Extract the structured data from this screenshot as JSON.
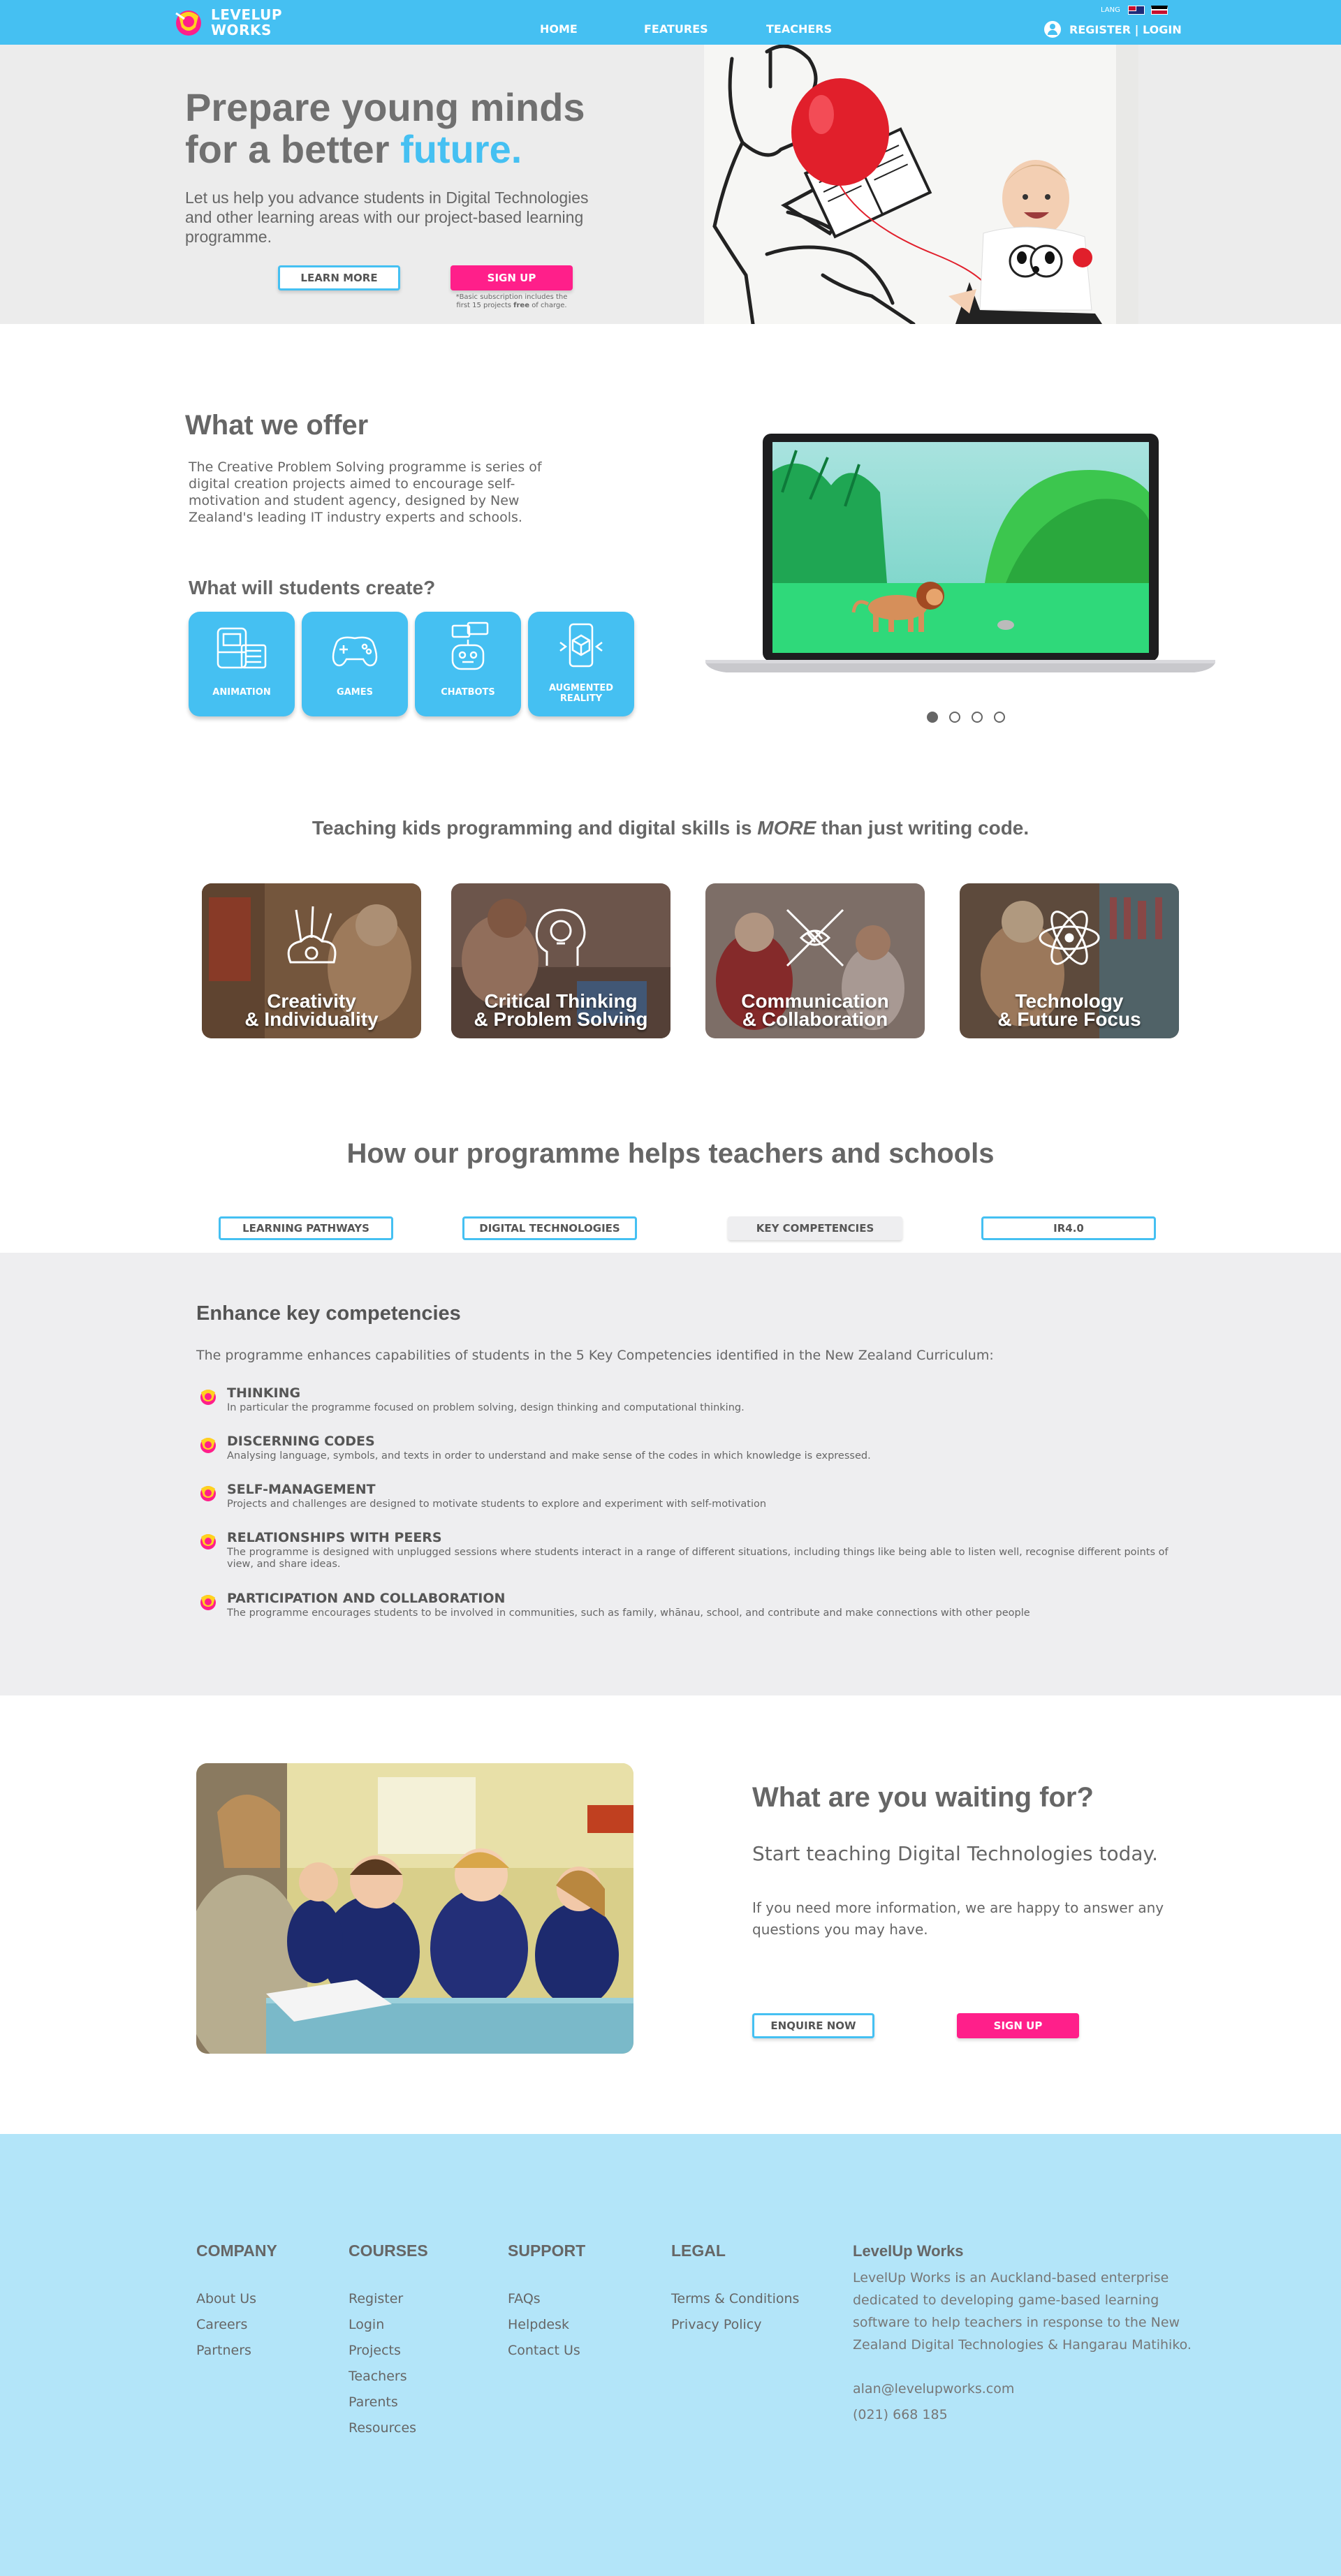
{
  "header": {
    "brand": "LEVELUP WORKS",
    "nav": [
      "HOME",
      "FEATURES",
      "TEACHERS"
    ],
    "lang_label": "LANG",
    "account": "REGISTER | LOGIN",
    "colors": {
      "brand_blue": "#45c0f2",
      "brand_pink": "#ff1f8a"
    }
  },
  "hero": {
    "title_line1": "Prepare young minds",
    "title_line2": "for a better",
    "title_highlight": "future.",
    "subtitle": "Let us help you advance students in Digital Technologies and other learning areas with our project-based learning programme.",
    "learn_more": "LEARN MORE",
    "sign_up": "SIGN UP",
    "note_1": "*Basic subscription includes the",
    "note_2": "first 15 projects",
    "note_bold": "free",
    "note_3": "of charge."
  },
  "offer": {
    "title": "What we offer",
    "text": "The Creative Problem Solving programme is series of digital creation projects aimed to encourage self-motivation and student agency, designed by New Zealand's leading IT industry experts and schools.",
    "create_title": "What will students create?",
    "tiles": [
      {
        "label": "ANIMATION",
        "icon": "film-icon"
      },
      {
        "label": "GAMES",
        "icon": "gamepad-icon"
      },
      {
        "label": "CHATBOTS",
        "icon": "robot-icon"
      },
      {
        "label": "AUGMENTED REALITY",
        "icon": "ar-phone-icon"
      }
    ],
    "carousel_active": 1,
    "carousel_count": 4
  },
  "teaching": {
    "title_pre": "Teaching kids programming and digital skills is",
    "title_em": "MORE",
    "title_post": "than just writing code.",
    "cards": [
      {
        "line1": "Creativity",
        "line2": "& Individuality",
        "icon": "paint-brushes-icon"
      },
      {
        "line1": "Critical Thinking",
        "line2": "& Problem Solving",
        "icon": "lightbulb-head-icon"
      },
      {
        "line1": "Communication",
        "line2": "& Collaboration",
        "icon": "hands-icon"
      },
      {
        "line1": "Technology",
        "line2": "& Future Focus",
        "icon": "atom-icon"
      }
    ]
  },
  "how": {
    "title": "How our programme helps teachers and schools",
    "tabs": [
      "LEARNING PATHWAYS",
      "DIGITAL TECHNOLOGIES",
      "KEY COMPETENCIES",
      "IR4.0"
    ],
    "active_tab": 2,
    "section_title": "Enhance key competencies",
    "intro": "The programme enhances capabilities of students in the 5 Key Competencies identified in the New Zealand Curriculum:",
    "items": [
      {
        "title": "THINKING",
        "desc": "In particular the programme focused on problem solving, design thinking and computational thinking."
      },
      {
        "title": "DISCERNING CODES",
        "desc": "Analysing language, symbols, and texts in order to understand and make sense of the codes in which knowledge is expressed."
      },
      {
        "title": "SELF-MANAGEMENT",
        "desc": "Projects and challenges are designed to motivate students to explore and experiment with self-motivation"
      },
      {
        "title": "RELATIONSHIPS WITH PEERS",
        "desc": "The programme is designed with unplugged sessions where students interact in a range of different situations, including things like being able to listen well, recognise different points of view, and share ideas."
      },
      {
        "title": "PARTICIPATION AND COLLABORATION",
        "desc": "The programme encourages students to be involved in communities, such as family, whānau, school, and contribute and make connections with other people"
      }
    ]
  },
  "cta": {
    "title": "What are you waiting for?",
    "subtitle": "Start teaching Digital Technologies today.",
    "text": "If you need more information, we are happy to answer any questions you may have.",
    "enquire": "ENQUIRE NOW",
    "sign_up": "SIGN UP"
  },
  "footer": {
    "company": {
      "heading": "COMPANY",
      "links": [
        "About Us",
        "Careers",
        "Partners"
      ]
    },
    "courses": {
      "heading": "COURSES",
      "links": [
        "Register",
        "Login",
        "Projects",
        "Teachers",
        "Parents",
        "Resources"
      ]
    },
    "support": {
      "heading": "SUPPORT",
      "links": [
        "FAQs",
        "Helpdesk",
        "Contact Us"
      ]
    },
    "legal": {
      "heading": "LEGAL",
      "links": [
        "Terms & Conditions",
        "Privacy Policy"
      ]
    },
    "about": {
      "heading": "LevelUp Works",
      "text": "LevelUp Works is an Auckland-based enterprise dedicated to developing game-based learning software to help teachers in response to the New Zealand Digital Technologies & Hangarau Matihiko.",
      "email": "alan@levelupworks.com",
      "phone": "(021) 668 185"
    }
  }
}
